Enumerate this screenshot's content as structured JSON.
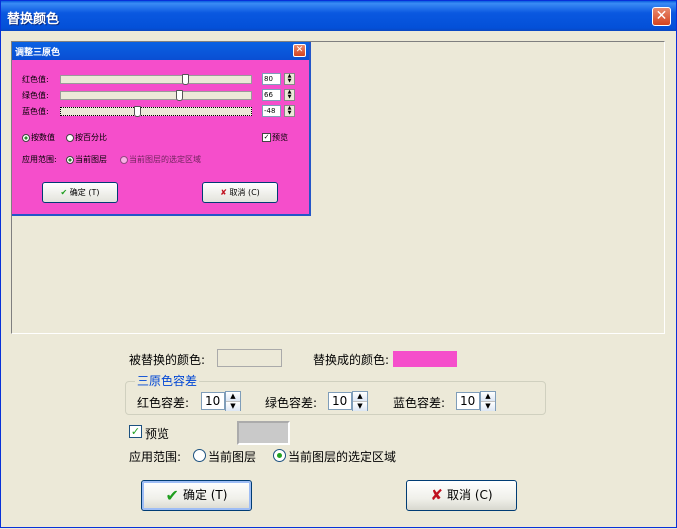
{
  "window": {
    "title": "替换颜色"
  },
  "inner_dialog": {
    "title": "调整三原色",
    "sliders": [
      {
        "label": "红色值:",
        "value": "80",
        "fraction": 0.66
      },
      {
        "label": "绿色值:",
        "value": "66",
        "fraction": 0.63
      },
      {
        "label": "蓝色值:",
        "value": "-48",
        "fraction": 0.4
      }
    ],
    "mode_options": [
      "按数值",
      "按百分比"
    ],
    "preview_label": "预览",
    "scope_label": "应用范围:",
    "scope_options": [
      "当前图层",
      "当前图层的选定区域"
    ],
    "ok_label": "确定 (T)",
    "cancel_label": "取消 (C)"
  },
  "replace": {
    "source_label": "被替换的颜色:",
    "target_label": "替换成的颜色:",
    "target_color": "#f54ecb"
  },
  "tolerance": {
    "legend": "三原色容差",
    "red_label": "红色容差:",
    "red_value": "10",
    "green_label": "绿色容差:",
    "green_value": "10",
    "blue_label": "蓝色容差:",
    "blue_value": "10"
  },
  "preview": {
    "label": "预览",
    "checked": true
  },
  "scope": {
    "label": "应用范围:",
    "option_layer": "当前图层",
    "option_selection": "当前图层的选定区域",
    "selected": "option_selection"
  },
  "buttons": {
    "ok": "确定 (T)",
    "cancel": "取消 (C)"
  },
  "colors": {
    "accent": "#0a58e0",
    "pink": "#f54ecb",
    "check_green": "#21a121"
  }
}
